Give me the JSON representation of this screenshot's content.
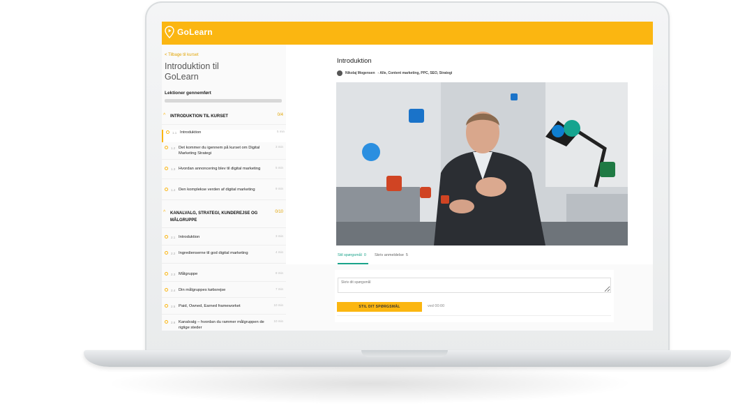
{
  "brand": {
    "name": "GoLearn",
    "color": "#fbb611"
  },
  "sidebar": {
    "back_link": "< Tilbage til kurset",
    "course_title": "Introduktion til GoLearn",
    "progress_label": "Lektioner gennemført",
    "progress_fraction": 0,
    "sections": [
      {
        "title": "INTRODUKTION TIL KURSET",
        "count": "0/4",
        "lessons": [
          {
            "num": "1.1",
            "title": "Introduktion",
            "duration": "5 min"
          },
          {
            "num": "1.2",
            "title": "Det kommer du igennem på kurset om Digital Marketing Strategi",
            "duration": "3 min"
          },
          {
            "num": "1.3",
            "title": "Hvordan annoncering blev til digital marketing",
            "duration": "5 min"
          },
          {
            "num": "1.4",
            "title": "Den komplekse verden af digital marketing",
            "duration": "9 min"
          }
        ]
      },
      {
        "title": "KANALVALG, STRATEGI, KUNDEREJSE OG MÅLGRUPPE",
        "count": "0/10",
        "lessons": [
          {
            "num": "2.1",
            "title": "Introduktion",
            "duration": "3 min"
          },
          {
            "num": "2.2",
            "title": "Ingredienserne til god digital marketing",
            "duration": "4 min"
          },
          {
            "num": "2.3",
            "title": "Målgruppe",
            "duration": "8 min"
          },
          {
            "num": "2.4",
            "title": "Din målgruppes købsrejse",
            "duration": "7 min"
          },
          {
            "num": "2.5",
            "title": "Paid, Owned, Earned frameworket",
            "duration": "10 min"
          },
          {
            "num": "2.6",
            "title": "Kanalvalg – hvordan du rammer målgruppen de rigtige steder",
            "duration": "10 min"
          }
        ]
      }
    ]
  },
  "main": {
    "heading": "Introduktion",
    "author_name": "Nikolaj Mogensen",
    "author_tags": "- Alle, Content marketing, PPC, SEO, Strategi",
    "tabs": [
      {
        "label": "Stil spørgsmål",
        "count": "0"
      },
      {
        "label": "Skriv anmeldelse",
        "count": "5"
      }
    ],
    "question_placeholder": "Skriv dit spørgsmål",
    "submit_label": "STIL DIT SPØRGSMÅL",
    "time_label": "ved 00:00"
  }
}
